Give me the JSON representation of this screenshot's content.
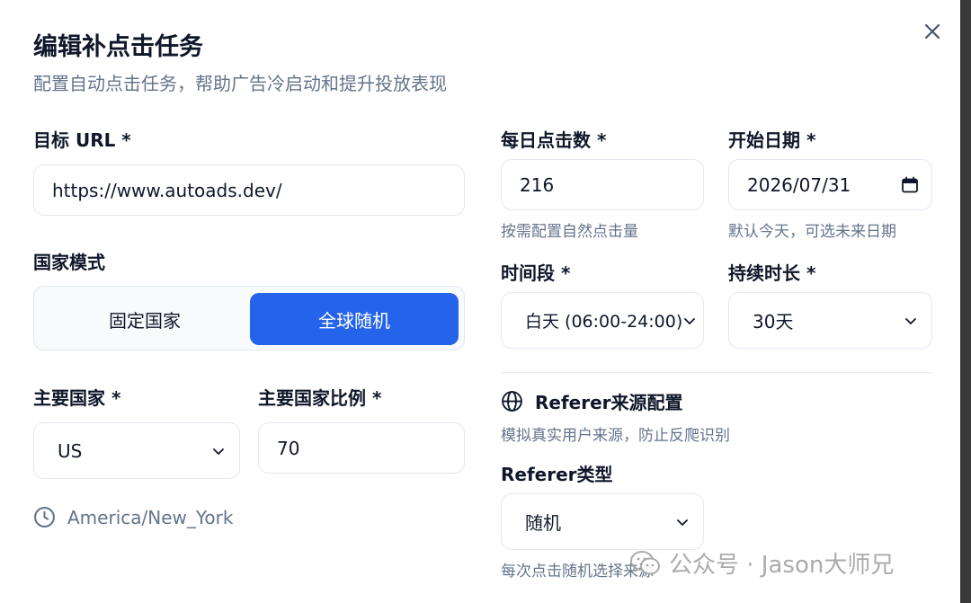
{
  "dialog": {
    "title": "编辑补点击任务",
    "subtitle": "配置自动点击任务，帮助广告冷启动和提升投放表现"
  },
  "target_url": {
    "label": "目标 URL *",
    "value": "https://www.autoads.dev/"
  },
  "country_mode": {
    "label": "国家模式",
    "options": [
      "固定国家",
      "全球随机"
    ],
    "selected": "全球随机"
  },
  "main_country": {
    "label": "主要国家 *",
    "value": "US"
  },
  "main_country_ratio": {
    "label": "主要国家比例 *",
    "value": "70"
  },
  "timezone": {
    "value": "America/New_York"
  },
  "daily_clicks": {
    "label": "每日点击数 *",
    "value": "216",
    "hint": "按需配置自然点击量"
  },
  "start_date": {
    "label": "开始日期 *",
    "value": "2026/07/31",
    "hint": "默认今天，可选未来日期"
  },
  "time_slot": {
    "label": "时间段 *",
    "value": "白天 (06:00-24:00)"
  },
  "duration": {
    "label": "持续时长 *",
    "value": "30天"
  },
  "referer": {
    "section_title": "Referer来源配置",
    "section_hint": "模拟真实用户来源，防止反爬识别",
    "type_label": "Referer类型",
    "type_value": "随机",
    "type_hint": "每次点击随机选择来源"
  },
  "watermark": {
    "text": "公众号 · Jason大师兄"
  },
  "colors": {
    "primary": "#2563eb",
    "muted": "#64748b",
    "border": "#e2e8f0"
  }
}
